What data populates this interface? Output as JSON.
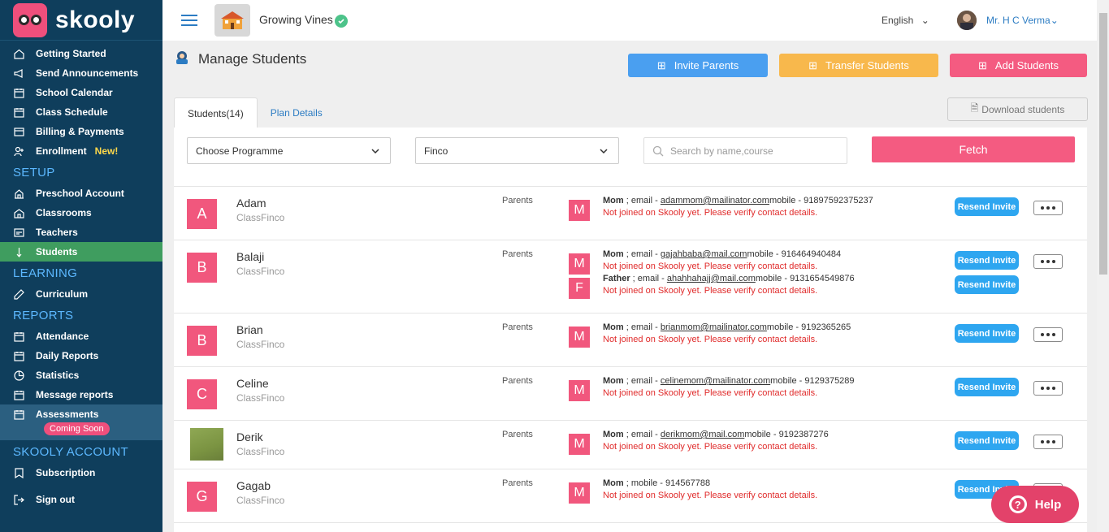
{
  "brand": {
    "name": "skooly"
  },
  "sidebar": {
    "top_items": [
      {
        "label": "Getting Started",
        "icon": "home-icon"
      },
      {
        "label": "Send Announcements",
        "icon": "megaphone-icon"
      },
      {
        "label": "School Calendar",
        "icon": "calendar-icon"
      },
      {
        "label": "Class Schedule",
        "icon": "calendar-icon"
      },
      {
        "label": "Billing & Payments",
        "icon": "billing-icon"
      },
      {
        "label": "Enrollment",
        "icon": "user-add-icon",
        "badge": "New!"
      }
    ],
    "setup_title": "SETUP",
    "setup_items": [
      {
        "label": "Preschool Account",
        "icon": "building-icon"
      },
      {
        "label": "Classrooms",
        "icon": "classroom-icon"
      },
      {
        "label": "Teachers",
        "icon": "teacher-icon"
      },
      {
        "label": "Students",
        "icon": "student-icon",
        "active": true
      }
    ],
    "learning_title": "LEARNING",
    "learning_items": [
      {
        "label": "Curriculum",
        "icon": "curriculum-icon"
      }
    ],
    "reports_title": "REPORTS",
    "reports_items": [
      {
        "label": "Attendance",
        "icon": "calendar-icon"
      },
      {
        "label": "Daily Reports",
        "icon": "calendar-icon"
      },
      {
        "label": "Statistics",
        "icon": "pie-chart-icon"
      },
      {
        "label": "Message reports",
        "icon": "calendar-icon"
      },
      {
        "label": "Assessments",
        "icon": "calendar-icon",
        "badge": "Coming Soon"
      }
    ],
    "account_title": "SKOOLY ACCOUNT",
    "account_items": [
      {
        "label": "Subscription",
        "icon": "bookmark-icon"
      },
      {
        "label": "Sign out",
        "icon": "sign-out-icon"
      }
    ]
  },
  "topbar": {
    "school_name": "Growing Vines",
    "language": "English",
    "user_name": "Mr. H C Verma"
  },
  "page": {
    "title": "Manage Students",
    "invite_parents": "Invite Parents",
    "transfer_students": "Transfer Students",
    "add_students": "Add Students",
    "download": "Download students",
    "tabs": [
      {
        "label": "Students(14)"
      },
      {
        "label": "Plan Details"
      }
    ]
  },
  "filters": {
    "programme": "Choose Programme",
    "class": "Finco",
    "search_placeholder": "Search by name,course",
    "fetch": "Fetch"
  },
  "colors": {
    "primary": "#0f3e5c",
    "accent": "#f45b81",
    "active_nav": "#3f9d5f",
    "link": "#2c7cc3"
  },
  "common": {
    "parents_label": "Parents",
    "resend": "Resend Invite",
    "warning": "Not joined on Skooly yet. Please verify contact details."
  },
  "students": [
    {
      "initial": "A",
      "name": "Adam",
      "class": "ClassFinco",
      "parents": [
        {
          "initial": "M",
          "relation": "Mom",
          "email": "adammom@mailinator.com",
          "mobile": "91897592375237"
        }
      ]
    },
    {
      "initial": "B",
      "name": "Balaji",
      "class": "ClassFinco",
      "parents": [
        {
          "initial": "M",
          "relation": "Mom",
          "email": "gajahbaba@mail.com",
          "mobile": "916464940484"
        },
        {
          "initial": "F",
          "relation": "Father",
          "email": "ahahhahajj@mail.com",
          "mobile": "9131654549876"
        }
      ]
    },
    {
      "initial": "B",
      "name": "Brian",
      "class": "ClassFinco",
      "parents": [
        {
          "initial": "M",
          "relation": "Mom",
          "email": "brianmom@mailinator.com",
          "mobile": "9192365265"
        }
      ]
    },
    {
      "initial": "C",
      "name": "Celine",
      "class": "ClassFinco",
      "parents": [
        {
          "initial": "M",
          "relation": "Mom",
          "email": "celinemom@mailinator.com",
          "mobile": "9129375289"
        }
      ]
    },
    {
      "initial": "",
      "photo": true,
      "name": "Derik",
      "class": "ClassFinco",
      "parents": [
        {
          "initial": "M",
          "relation": "Mom",
          "email": "derikmom@mail.com",
          "mobile": "9192387276"
        }
      ]
    },
    {
      "initial": "G",
      "name": "Gagab",
      "class": "ClassFinco",
      "parents": [
        {
          "initial": "M",
          "relation": "Mom",
          "email": "",
          "mobile": "914567788"
        }
      ]
    }
  ],
  "help": {
    "label": "Help"
  }
}
